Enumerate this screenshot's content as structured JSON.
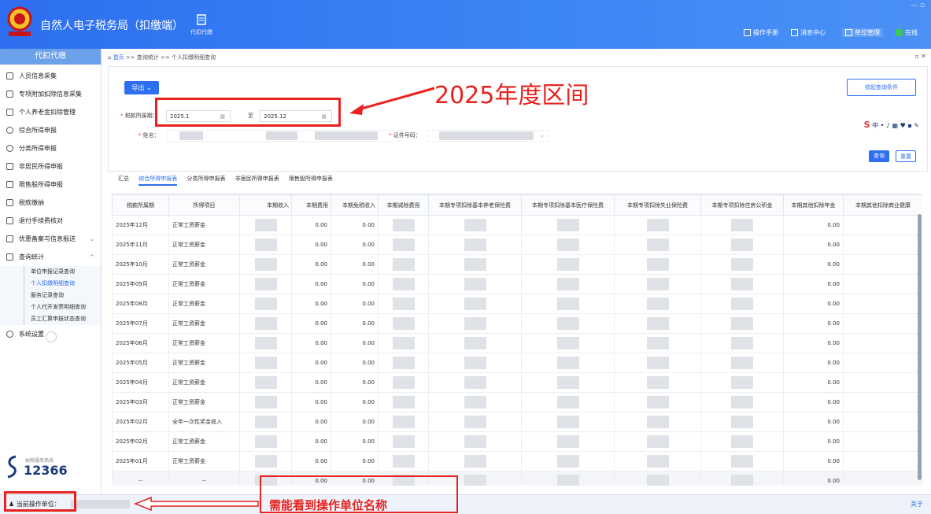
{
  "header": {
    "app_title": "自然人电子税务局（扣缴端）",
    "agency_label": "代扣代缴",
    "right_items": [
      "操作手册",
      "消息中心",
      "单位管理",
      "在线"
    ],
    "accent_color": "#2d6ff0"
  },
  "breadcrumb": {
    "home": "首页",
    "path": ">> 查询统计 >> 个人扣缴明细查询"
  },
  "sidebar": {
    "title": "代扣代缴",
    "items": [
      {
        "label": "人员信息采集",
        "icon": "user-icon"
      },
      {
        "label": "专项附加扣除信息采集",
        "icon": "list-icon"
      },
      {
        "label": "个人养老金扣除管理",
        "icon": "doc-icon"
      },
      {
        "label": "综合所得申报",
        "icon": "layers-icon"
      },
      {
        "label": "分类所得申报",
        "icon": "clock-icon"
      },
      {
        "label": "非居民所得申报",
        "icon": "person-icon"
      },
      {
        "label": "限售股所得申报",
        "icon": "chart-icon"
      },
      {
        "label": "税款缴纳",
        "icon": "card-icon"
      },
      {
        "label": "退付手续费核对",
        "icon": "receipt-icon"
      },
      {
        "label": "优惠备案与信息报送",
        "icon": "tag-icon"
      },
      {
        "label": "查询统计",
        "icon": "search-icon"
      }
    ],
    "subitems": [
      "单位申报记录查询",
      "个人扣缴明细查询",
      "服务记录查询",
      "个人代开发票明细查询",
      "员工汇算申报状态查询"
    ],
    "last_item": "系统设置",
    "hotline_small": "纳税服务热线",
    "hotline": "12366"
  },
  "query": {
    "export_label": "导出",
    "collapse_label": "收起查询条件",
    "period_label": "税款所属期：",
    "period_from": "2025.1",
    "to_label": "至",
    "period_to": "2025.12",
    "name_label": "姓名：",
    "id_label": "证件号码：",
    "search_label": "查询",
    "reset_label": "重置",
    "ime_label": "中"
  },
  "tabs": [
    "汇总",
    "综合所得申报表",
    "分类所得申报表",
    "非居民所得申报表",
    "限售股所得申报表"
  ],
  "table": {
    "columns": [
      "税款所属期",
      "所得项目",
      "本期收入",
      "本期费用",
      "本期免税收入",
      "本期减除费用",
      "本期专项扣除基本养老保险费",
      "本期专项扣除基本医疗保险费",
      "本期专项扣除失业保险费",
      "本期专项扣除住房公积金",
      "本期其他扣除年金",
      "本期其他扣除商业健康"
    ],
    "rows": [
      {
        "period": "2025年12月",
        "item": "正常工资薪金",
        "fee": "0.00",
        "free": "0.00",
        "ann": "0.00"
      },
      {
        "period": "2025年11月",
        "item": "正常工资薪金",
        "fee": "0.00",
        "free": "0.00",
        "ann": "0.00"
      },
      {
        "period": "2025年10月",
        "item": "正常工资薪金",
        "fee": "0.00",
        "free": "0.00",
        "ann": "0.00"
      },
      {
        "period": "2025年09月",
        "item": "正常工资薪金",
        "fee": "0.00",
        "free": "0.00",
        "ann": "0.00"
      },
      {
        "period": "2025年08月",
        "item": "正常工资薪金",
        "fee": "0.00",
        "free": "0.00",
        "ann": "0.00"
      },
      {
        "period": "2025年07月",
        "item": "正常工资薪金",
        "fee": "0.00",
        "free": "0.00",
        "ann": "0.00"
      },
      {
        "period": "2025年06月",
        "item": "正常工资薪金",
        "fee": "0.00",
        "free": "0.00",
        "ann": "0.00"
      },
      {
        "period": "2025年05月",
        "item": "正常工资薪金",
        "fee": "0.00",
        "free": "0.00",
        "ann": "0.00"
      },
      {
        "period": "2025年04月",
        "item": "正常工资薪金",
        "fee": "0.00",
        "free": "0.00",
        "ann": "0.00"
      },
      {
        "period": "2025年03月",
        "item": "正常工资薪金",
        "fee": "0.00",
        "free": "0.00",
        "ann": "0.00"
      },
      {
        "period": "2025年02月",
        "item": "全年一次性奖金收入",
        "fee": "0.00",
        "free": "0.00",
        "ann": "0.00"
      },
      {
        "period": "2025年02月",
        "item": "正常工资薪金",
        "fee": "0.00",
        "free": "0.00",
        "ann": "0.00"
      },
      {
        "period": "2025年01月",
        "item": "正常工资薪金",
        "fee": "0.00",
        "free": "0.00",
        "ann": "0.00"
      }
    ],
    "total": {
      "period": "--",
      "item": "--",
      "fee": "0.00",
      "free": "0.00",
      "ann": "0.00"
    }
  },
  "footer": {
    "operator_label": "当前操作单位：",
    "about_label": "关于"
  },
  "annotations": {
    "period_note": "2025年度区间",
    "unit_note": "需能看到操作单位名称",
    "annotation_color": "#e8231f"
  }
}
